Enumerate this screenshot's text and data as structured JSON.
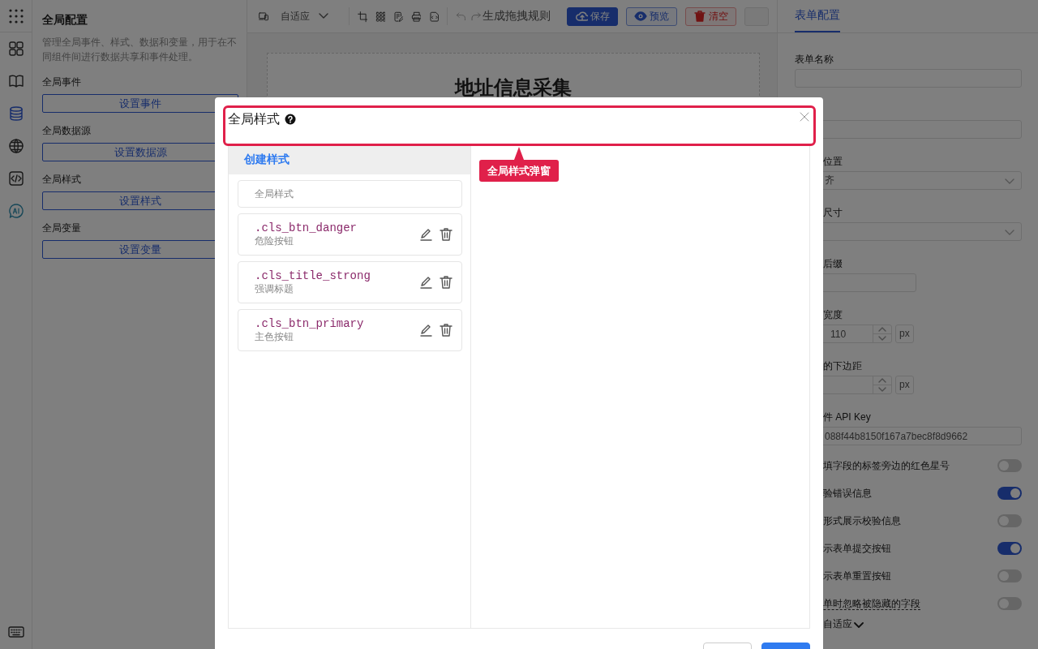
{
  "rail": [
    {
      "selected": false
    },
    {
      "selected": false
    },
    {
      "selected": false
    },
    {
      "selected": true
    },
    {
      "selected": false
    },
    {
      "selected": false
    },
    {
      "selected": false
    },
    {
      "selected": false
    }
  ],
  "config_panel": {
    "title": "全局配置",
    "description": "管理全局事件、样式、数据和变量，用于在不同组件间进行数据共享和事件处理。",
    "sections": [
      {
        "label": "全局事件",
        "button": "设置事件"
      },
      {
        "label": "全局数据源",
        "button": "设置数据源"
      },
      {
        "label": "全局样式",
        "button": "设置样式"
      },
      {
        "label": "全局变量",
        "button": "设置变量"
      }
    ]
  },
  "toolbar": {
    "device_select": "自适应",
    "generate_rule": "生成拖拽规则",
    "buttons": [
      {
        "kind": "primary",
        "label": "保存"
      },
      {
        "kind": "outline",
        "label": "预览"
      },
      {
        "kind": "danger",
        "label": "清空"
      },
      {
        "kind": "partial"
      }
    ]
  },
  "canvas": {
    "title": "地址信息采集"
  },
  "props_panel": {
    "tab": {
      "label": "表单配置",
      "selected": true
    },
    "top_fields": [
      {
        "kind": "input",
        "label": "表单名称"
      },
      {
        "kind": "input"
      }
    ],
    "fields": [
      {
        "kind": "select",
        "label": "位置",
        "value": "齐"
      },
      {
        "kind": "select",
        "label": "尺寸"
      },
      {
        "kind": "short_input",
        "label": "后缀"
      },
      {
        "kind": "number",
        "label": "宽度",
        "value": "110",
        "unit": "px"
      },
      {
        "kind": "number",
        "label": "的下边距",
        "unit": "px"
      },
      {
        "kind": "input",
        "label": "件 API Key",
        "value": "088f44b8150f167a7bec8f8d9662"
      },
      {
        "kind": "switch",
        "label": "填字段的标签旁边的红色星号",
        "on": false
      },
      {
        "kind": "switch",
        "label": "验错误信息",
        "on": true
      },
      {
        "kind": "switch",
        "label": "形式展示校验信息",
        "on": false
      },
      {
        "kind": "switch",
        "label": "示表单提交按钮",
        "on": true
      },
      {
        "kind": "switch",
        "label": "示表单重置按钮",
        "on": false
      },
      {
        "kind": "hint_switch",
        "label": "单时忽略被隐藏的字段",
        "on": false
      },
      {
        "kind": "link",
        "label": "自适应"
      }
    ]
  },
  "modal": {
    "title": "全局样式",
    "create_label": "创建样式",
    "styles": [
      {
        "kind": "global",
        "name": "全局样式"
      },
      {
        "kind": "class",
        "name": ".cls_btn_danger",
        "description": "危险按钮"
      },
      {
        "kind": "class",
        "name": ".cls_title_strong",
        "description": "强调标题"
      },
      {
        "kind": "class",
        "name": ".cls_btn_primary",
        "description": "主色按钮"
      }
    ],
    "footer_buttons": [
      {
        "kind": "default"
      },
      {
        "kind": "primary"
      }
    ]
  },
  "annotation": {
    "label": "全局样式弹窗"
  }
}
